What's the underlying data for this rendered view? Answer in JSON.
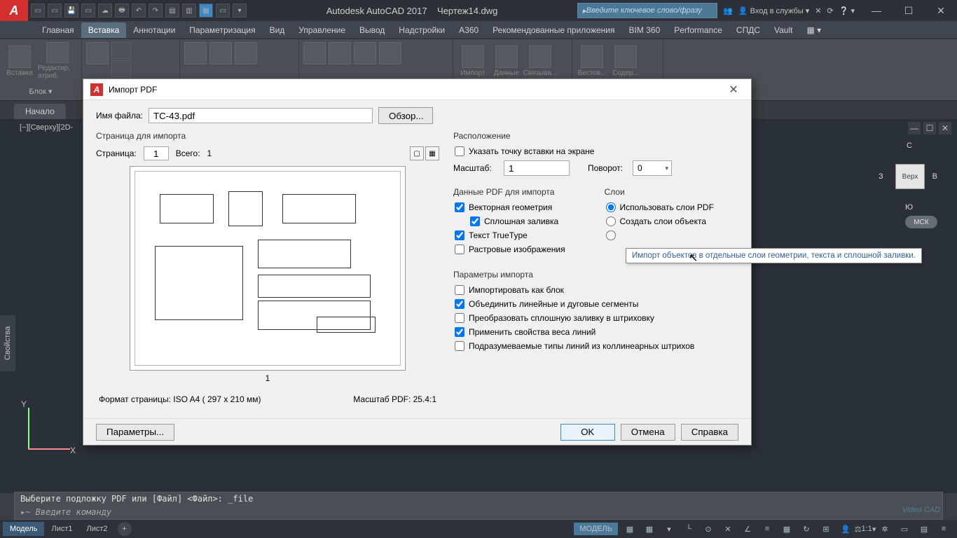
{
  "titlebar": {
    "app_name": "Autodesk AutoCAD 2017",
    "document": "Чертеж14.dwg",
    "search_placeholder": "Введите ключевое слово/фразу",
    "signin": "Вход в службы"
  },
  "menu": {
    "items": [
      "Главная",
      "Вставка",
      "Аннотации",
      "Параметризация",
      "Вид",
      "Управление",
      "Вывод",
      "Надстройки",
      "A360",
      "Рекомендованные приложения",
      "BIM 360",
      "Performance",
      "СПДС",
      "Vault"
    ],
    "active_index": 1
  },
  "ribbon": {
    "panels": [
      {
        "label": "Блок ▾",
        "buttons": [
          "Вставка",
          "Редактир. атриб."
        ]
      },
      {
        "label": "",
        "buttons": []
      },
      {
        "label": "",
        "buttons": []
      },
      {
        "label": "",
        "buttons": [
          "Импорт",
          "Данные",
          "Связыва..."
        ]
      },
      {
        "label": "",
        "buttons": [
          "Вестов...",
          "Содер..."
        ]
      }
    ]
  },
  "drawtabs": {
    "start": "Начало"
  },
  "viewport": {
    "label": "[−][Сверху][2D-",
    "viewcube": {
      "face": "Верх",
      "n": "С",
      "s": "Ю",
      "e": "В",
      "w": "З"
    },
    "wcs": "МСК",
    "ucs": {
      "x": "X",
      "y": "Y"
    },
    "sidebar": "Свойства"
  },
  "commandline": {
    "history": "Выберите подложку PDF или [Файл] <Файл>: _file",
    "prompt": "▸~ Введите команду"
  },
  "statusbar": {
    "tabs": [
      "Модель",
      "Лист1",
      "Лист2"
    ],
    "right_model": "МОДЕЛЬ",
    "scale": "1:1"
  },
  "dialog": {
    "title": "Импорт PDF",
    "filename_label": "Имя файла:",
    "filename": "TC-43.pdf",
    "browse": "Обзор...",
    "page_group": "Страница для импорта",
    "page_label": "Страница:",
    "page_value": "1",
    "total_label": "Всего:",
    "total_value": "1",
    "page_num": "1",
    "format": "Формат страницы:  ISO A4 ( 297 x  210 мм)",
    "pdf_scale": "Масштаб PDF:  25.4:1",
    "location": {
      "title": "Расположение",
      "specify": "Указать точку вставки на экране",
      "scale_label": "Масштаб:",
      "scale_value": "1",
      "rotation_label": "Поворот:",
      "rotation_value": "0"
    },
    "pdfdata": {
      "title": "Данные PDF для импорта",
      "vector": "Векторная геометрия",
      "solid": "Сплошная заливка",
      "truetype": "Текст TrueType",
      "raster": "Растровые изображения"
    },
    "layers": {
      "title": "Слои",
      "use_pdf": "Использовать слои PDF",
      "create_obj": "Создать слои объекта"
    },
    "import_params": {
      "title": "Параметры импорта",
      "as_block": "Импортировать как блок",
      "join": "Объединить линейные и дуговые сегменты",
      "convert": "Преобразовать сплошную заливку в штриховку",
      "lineweight": "Применить свойства веса линий",
      "infer": "Подразумеваемые типы линий из коллинеарных штрихов"
    },
    "tooltip": "Импорт объектов в отдельные слои геометрии, текста и сплошной заливки.",
    "options": "Параметры...",
    "ok": "OK",
    "cancel": "Отмена",
    "help": "Справка"
  },
  "watermark": "Video\nCAD"
}
